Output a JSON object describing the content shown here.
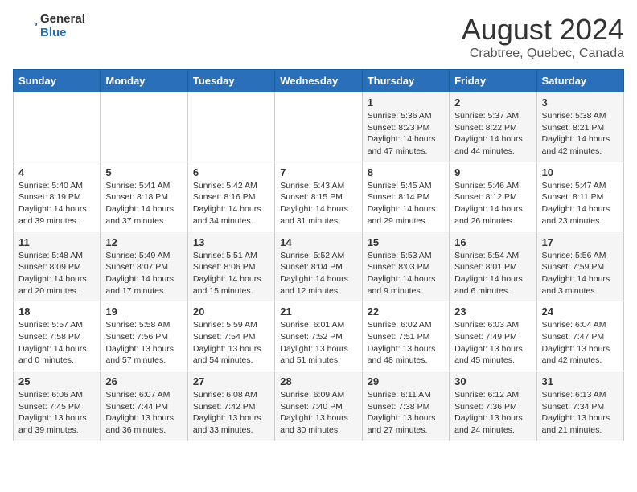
{
  "logo": {
    "general": "General",
    "blue": "Blue"
  },
  "title": "August 2024",
  "subtitle": "Crabtree, Quebec, Canada",
  "days_header": [
    "Sunday",
    "Monday",
    "Tuesday",
    "Wednesday",
    "Thursday",
    "Friday",
    "Saturday"
  ],
  "weeks": [
    [
      {
        "day": "",
        "info": ""
      },
      {
        "day": "",
        "info": ""
      },
      {
        "day": "",
        "info": ""
      },
      {
        "day": "",
        "info": ""
      },
      {
        "day": "1",
        "info": "Sunrise: 5:36 AM\nSunset: 8:23 PM\nDaylight: 14 hours and 47 minutes."
      },
      {
        "day": "2",
        "info": "Sunrise: 5:37 AM\nSunset: 8:22 PM\nDaylight: 14 hours and 44 minutes."
      },
      {
        "day": "3",
        "info": "Sunrise: 5:38 AM\nSunset: 8:21 PM\nDaylight: 14 hours and 42 minutes."
      }
    ],
    [
      {
        "day": "4",
        "info": "Sunrise: 5:40 AM\nSunset: 8:19 PM\nDaylight: 14 hours and 39 minutes."
      },
      {
        "day": "5",
        "info": "Sunrise: 5:41 AM\nSunset: 8:18 PM\nDaylight: 14 hours and 37 minutes."
      },
      {
        "day": "6",
        "info": "Sunrise: 5:42 AM\nSunset: 8:16 PM\nDaylight: 14 hours and 34 minutes."
      },
      {
        "day": "7",
        "info": "Sunrise: 5:43 AM\nSunset: 8:15 PM\nDaylight: 14 hours and 31 minutes."
      },
      {
        "day": "8",
        "info": "Sunrise: 5:45 AM\nSunset: 8:14 PM\nDaylight: 14 hours and 29 minutes."
      },
      {
        "day": "9",
        "info": "Sunrise: 5:46 AM\nSunset: 8:12 PM\nDaylight: 14 hours and 26 minutes."
      },
      {
        "day": "10",
        "info": "Sunrise: 5:47 AM\nSunset: 8:11 PM\nDaylight: 14 hours and 23 minutes."
      }
    ],
    [
      {
        "day": "11",
        "info": "Sunrise: 5:48 AM\nSunset: 8:09 PM\nDaylight: 14 hours and 20 minutes."
      },
      {
        "day": "12",
        "info": "Sunrise: 5:49 AM\nSunset: 8:07 PM\nDaylight: 14 hours and 17 minutes."
      },
      {
        "day": "13",
        "info": "Sunrise: 5:51 AM\nSunset: 8:06 PM\nDaylight: 14 hours and 15 minutes."
      },
      {
        "day": "14",
        "info": "Sunrise: 5:52 AM\nSunset: 8:04 PM\nDaylight: 14 hours and 12 minutes."
      },
      {
        "day": "15",
        "info": "Sunrise: 5:53 AM\nSunset: 8:03 PM\nDaylight: 14 hours and 9 minutes."
      },
      {
        "day": "16",
        "info": "Sunrise: 5:54 AM\nSunset: 8:01 PM\nDaylight: 14 hours and 6 minutes."
      },
      {
        "day": "17",
        "info": "Sunrise: 5:56 AM\nSunset: 7:59 PM\nDaylight: 14 hours and 3 minutes."
      }
    ],
    [
      {
        "day": "18",
        "info": "Sunrise: 5:57 AM\nSunset: 7:58 PM\nDaylight: 14 hours and 0 minutes."
      },
      {
        "day": "19",
        "info": "Sunrise: 5:58 AM\nSunset: 7:56 PM\nDaylight: 13 hours and 57 minutes."
      },
      {
        "day": "20",
        "info": "Sunrise: 5:59 AM\nSunset: 7:54 PM\nDaylight: 13 hours and 54 minutes."
      },
      {
        "day": "21",
        "info": "Sunrise: 6:01 AM\nSunset: 7:52 PM\nDaylight: 13 hours and 51 minutes."
      },
      {
        "day": "22",
        "info": "Sunrise: 6:02 AM\nSunset: 7:51 PM\nDaylight: 13 hours and 48 minutes."
      },
      {
        "day": "23",
        "info": "Sunrise: 6:03 AM\nSunset: 7:49 PM\nDaylight: 13 hours and 45 minutes."
      },
      {
        "day": "24",
        "info": "Sunrise: 6:04 AM\nSunset: 7:47 PM\nDaylight: 13 hours and 42 minutes."
      }
    ],
    [
      {
        "day": "25",
        "info": "Sunrise: 6:06 AM\nSunset: 7:45 PM\nDaylight: 13 hours and 39 minutes."
      },
      {
        "day": "26",
        "info": "Sunrise: 6:07 AM\nSunset: 7:44 PM\nDaylight: 13 hours and 36 minutes."
      },
      {
        "day": "27",
        "info": "Sunrise: 6:08 AM\nSunset: 7:42 PM\nDaylight: 13 hours and 33 minutes."
      },
      {
        "day": "28",
        "info": "Sunrise: 6:09 AM\nSunset: 7:40 PM\nDaylight: 13 hours and 30 minutes."
      },
      {
        "day": "29",
        "info": "Sunrise: 6:11 AM\nSunset: 7:38 PM\nDaylight: 13 hours and 27 minutes."
      },
      {
        "day": "30",
        "info": "Sunrise: 6:12 AM\nSunset: 7:36 PM\nDaylight: 13 hours and 24 minutes."
      },
      {
        "day": "31",
        "info": "Sunrise: 6:13 AM\nSunset: 7:34 PM\nDaylight: 13 hours and 21 minutes."
      }
    ]
  ]
}
